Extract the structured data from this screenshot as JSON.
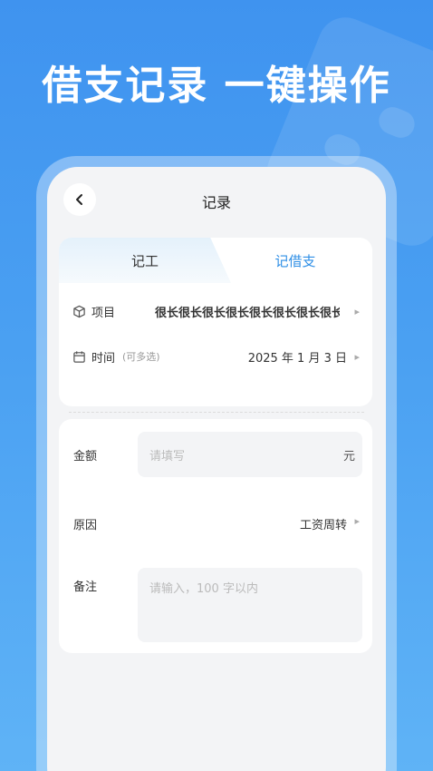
{
  "headline": "借支记录 一键操作",
  "nav": {
    "title": "记录"
  },
  "tabs": {
    "left": "记工",
    "right": "记借支"
  },
  "project": {
    "label": "项目",
    "value": "很长很长很长很长很长很长很长很长很长"
  },
  "time": {
    "label": "时间",
    "hint": "(可多选)",
    "value": "2025 年 1 月 3 日"
  },
  "amount": {
    "label": "金额",
    "placeholder": "请填写",
    "unit": "元"
  },
  "reason": {
    "label": "原因",
    "value": "工资周转"
  },
  "note": {
    "label": "备注",
    "placeholder": "请输入，100 字以内"
  },
  "colors": {
    "accent": "#2f8fe6",
    "background": "#4aa0f2"
  }
}
